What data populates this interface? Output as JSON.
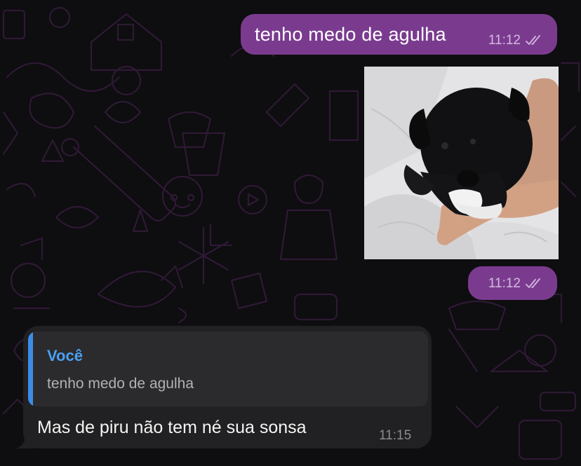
{
  "theme": {
    "outgoing_bubble": "#7a3b8f",
    "incoming_bubble": "#212123",
    "reply_accent": "#3c8ce7",
    "background": "#0e0d10"
  },
  "messages": [
    {
      "direction": "outgoing",
      "text": "tenho medo de agulha",
      "time": "11:12",
      "status": "read-double-check"
    },
    {
      "direction": "outgoing",
      "type": "photo",
      "photo_subject": "black puppy held in a hand",
      "time": "11:12",
      "status": "read-double-check"
    },
    {
      "direction": "incoming",
      "reply_to": {
        "sender": "Você",
        "text": "tenho medo de agulha"
      },
      "text": "Mas de piru não tem né sua sonsa",
      "time": "11:15"
    }
  ]
}
